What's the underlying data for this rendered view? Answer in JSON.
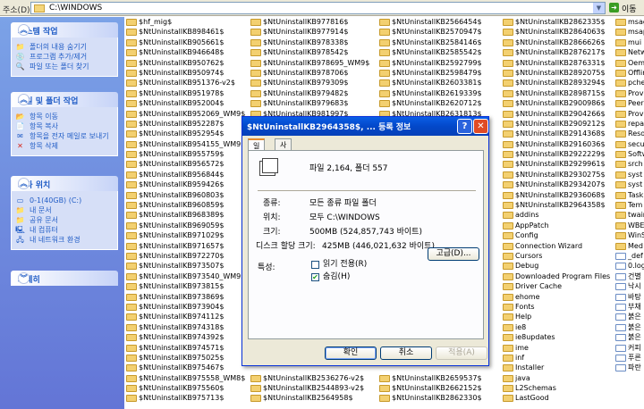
{
  "address_bar": {
    "label": "주소(D)",
    "path": "C:\\WINDOWS",
    "go_label": "이동"
  },
  "task_panes": [
    {
      "title": "시스템 작업",
      "items": [
        {
          "icon": "folder-hide-icon",
          "label": "폴더의 내용 숨기기"
        },
        {
          "icon": "add-remove-icon",
          "label": "프로그램 추가/제거"
        },
        {
          "icon": "search-icon",
          "label": "파일 또는 폴더 찾기"
        }
      ]
    },
    {
      "title": "파일 및 폴더 작업",
      "items": [
        {
          "icon": "move-icon",
          "label": "항목 이동"
        },
        {
          "icon": "copy-icon",
          "label": "항목 복사"
        },
        {
          "icon": "email-icon",
          "label": "항목을 전자 메일로 보내기"
        },
        {
          "icon": "delete-icon",
          "label": "항목 삭제"
        }
      ]
    },
    {
      "title": "기타 위치",
      "items": [
        {
          "icon": "drive-icon",
          "label": "0-1(40GB) (C:)"
        },
        {
          "icon": "folder-icon",
          "label": "내 문서"
        },
        {
          "icon": "folder-icon",
          "label": "공유 문서"
        },
        {
          "icon": "computer-icon",
          "label": "내 컴퓨터"
        },
        {
          "icon": "network-icon",
          "label": "내 네트워크 환경"
        }
      ]
    },
    {
      "title": "자세히",
      "items": []
    }
  ],
  "file_columns": [
    [
      "$hf_mig$",
      "$NtUninstallKB898461$",
      "$NtUninstallKB905661$",
      "$NtUninstallKB946648$",
      "$NtUninstallKB950762$",
      "$NtUninstallKB950974$",
      "$NtUninstallKB951376-v2$",
      "$NtUninstallKB951978$",
      "$NtUninstallKB952004$",
      "$NtUninstallKB952069_WM9$",
      "$NtUninstallKB952287$",
      "$NtUninstallKB952954$",
      "$NtUninstallKB954155_WM9$",
      "$NtUninstallKB955759$",
      "$NtUninstallKB956572$",
      "$NtUninstallKB956844$",
      "$NtUninstallKB959426$",
      "$NtUninstallKB960803$",
      "$NtUninstallKB960859$",
      "$NtUninstallKB968389$",
      "$NtUninstallKB969059$",
      "$NtUninstallKB971029$",
      "$NtUninstallKB971657$",
      "$NtUninstallKB972270$",
      "$NtUninstallKB973507$",
      "$NtUninstallKB973540_WM9$",
      "$NtUninstallKB973815$",
      "$NtUninstallKB973869$",
      "$NtUninstallKB973904$",
      "$NtUninstallKB974112$",
      "$NtUninstallKB974318$",
      "$NtUninstallKB974392$",
      "$NtUninstallKB974571$",
      "$NtUninstallKB975025$",
      "$NtUninstallKB975467$",
      "$NtUninstallKB975558_WM8$",
      "$NtUninstallKB975560$",
      "$NtUninstallKB975713$"
    ],
    [
      "$NtUninstallKB977816$",
      "$NtUninstallKB977914$",
      "$NtUninstallKB978338$",
      "$NtUninstallKB978542$",
      "$NtUninstallKB978695_WM9$",
      "$NtUninstallKB978706$",
      "$NtUninstallKB979309$",
      "$NtUninstallKB979482$",
      "$NtUninstallKB979683$",
      "$NtUninstallKB981997$",
      "",
      "",
      "",
      "",
      "",
      "",
      "",
      "",
      "",
      "",
      "",
      "",
      "",
      "",
      "",
      "",
      "",
      "",
      "",
      "",
      "",
      "",
      "",
      "",
      "",
      "$NtUninstallKB2536276-v2$",
      "$NtUninstallKB2544893-v2$",
      "$NtUninstallKB2564958$"
    ],
    [
      "$NtUninstallKB2566454$",
      "$NtUninstallKB2570947$",
      "$NtUninstallKB2584146$",
      "$NtUninstallKB2585542$",
      "$NtUninstallKB2592799$",
      "$NtUninstallKB2598479$",
      "$NtUninstallKB2603381$",
      "$NtUninstallKB2619339$",
      "$NtUninstallKB2620712$",
      "$NtUninstallKB2631813$",
      "",
      "",
      "",
      "",
      "",
      "",
      "",
      "",
      "",
      "",
      "",
      "",
      "",
      "",
      "",
      "",
      "",
      "",
      "",
      "",
      "",
      "",
      "",
      "",
      "",
      "$NtUninstallKB2659537$",
      "$NtUninstallKB2662152$",
      "$NtUninstallKB2862330$"
    ],
    [
      "$NtUninstallKB2862335$",
      "$NtUninstallKB2864063$",
      "$NtUninstallKB2866626$",
      "$NtUninstallKB2876217$",
      "$NtUninstallKB2876331$",
      "$NtUninstallKB2892075$",
      "$NtUninstallKB2893294$",
      "$NtUninstallKB2898715$",
      "$NtUninstallKB2900986$",
      "$NtUninstallKB2904266$",
      "$NtUninstallKB2909212$",
      "$NtUninstallKB2914368$",
      "$NtUninstallKB2916036$",
      "$NtUninstallKB2922229$",
      "$NtUninstallKB2929961$",
      "$NtUninstallKB2930275$",
      "$NtUninstallKB2934207$",
      "$NtUninstallKB2936068$",
      "$NtUninstallKB2964358$",
      "addins",
      "AppPatch",
      "Config",
      "Connection Wizard",
      "Cursors",
      "Debug",
      "Downloaded Program Files",
      "Driver Cache",
      "ehome",
      "Fonts",
      "Help",
      "ie8",
      "ie8updates",
      "ime",
      "inf",
      "Installer",
      "java",
      "L2Schemas",
      "LastGood"
    ],
    [
      "msag",
      "msap",
      "mui",
      "Netw",
      "Oem",
      "Offlin",
      "pche",
      "Provi",
      "Peern",
      "Prov",
      "repa",
      "Reso",
      "secu",
      "Softw",
      "srch",
      "syst",
      "syst",
      "Task",
      "Tem",
      "twair",
      "WBE",
      "WinS",
      "Med",
      "_def",
      "0.log",
      "건별",
      "낙시",
      "바탕",
      "부채",
      "붉은",
      "붉은",
      "붉은",
      "커피",
      "푸른",
      "파란",
      "",
      "",
      ""
    ]
  ],
  "dialog": {
    "title": "$NtUninstallKB2964358$, ... 등록 정보",
    "tabs": [
      "일반",
      "사용자 지정"
    ],
    "summary": "파일 2,164, 폴더 557",
    "rows": [
      {
        "label": "종류:",
        "value": "모든 종류 파일 폴더"
      },
      {
        "label": "위치:",
        "value": "모두 C:\\WINDOWS"
      },
      {
        "label": "크기:",
        "value": "500MB (524,857,743 바이트)"
      },
      {
        "label": "디스크 할당 크기:",
        "value": "425MB (446,021,632 바이트)"
      }
    ],
    "attributes_label": "특성:",
    "readonly_label": "읽기 전용(R)",
    "hidden_label": "숨김(H)",
    "advanced_label": "고급(D)...",
    "ok_label": "확인",
    "cancel_label": "취소",
    "apply_label": "적용(A)"
  }
}
